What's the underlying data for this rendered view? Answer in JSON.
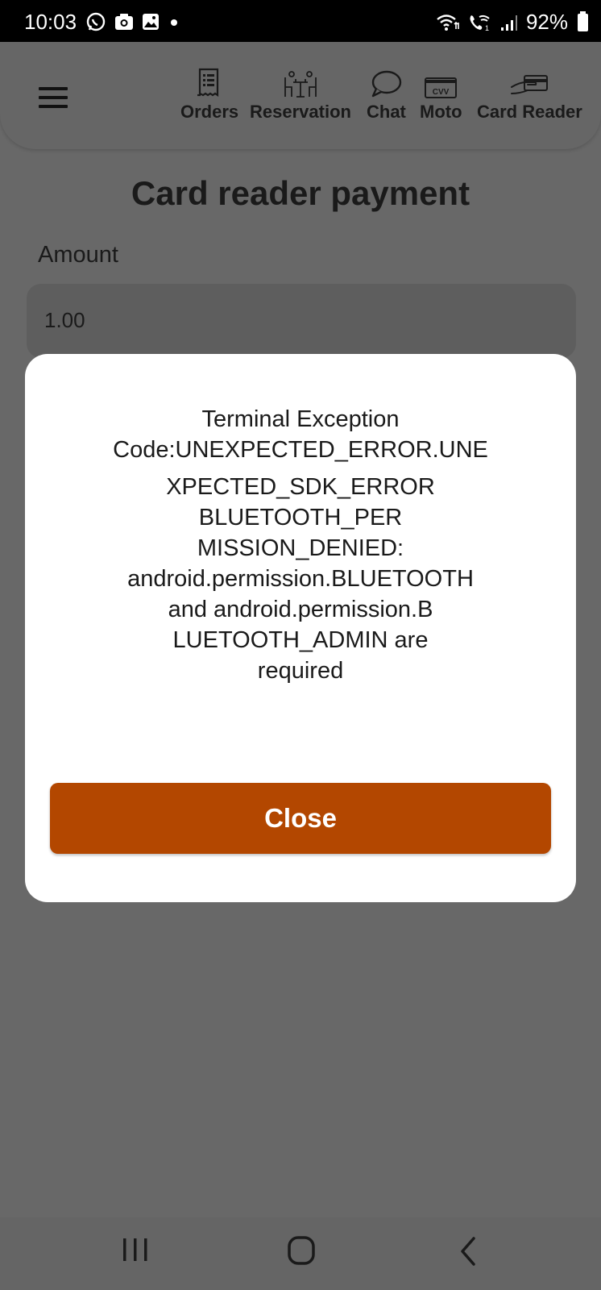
{
  "status_bar": {
    "time": "10:03",
    "battery": "92%",
    "icons": [
      "whatsapp-icon",
      "camera-icon",
      "gallery-icon",
      "dot-icon",
      "wifi-icon",
      "wifi-calling-icon",
      "signal-icon",
      "battery-icon"
    ]
  },
  "header": {
    "tabs": [
      {
        "label": "Orders",
        "icon": "receipt-icon"
      },
      {
        "label": "Reservation",
        "icon": "dining-table-icon"
      },
      {
        "label": "Chat",
        "icon": "chat-bubble-icon"
      },
      {
        "label": "Moto",
        "icon": "cvv-card-icon"
      },
      {
        "label": "Card Reader",
        "icon": "card-reader-icon"
      }
    ]
  },
  "page": {
    "title": "Card reader payment",
    "amount_label": "Amount",
    "amount_value": "1.00"
  },
  "dialog": {
    "lines": [
      "Terminal Exception",
      "Code:UNEXPECTED_ERROR.UNE",
      "XPECTED_SDK_ERROR",
      "BLUETOOTH_PER",
      "MISSION_DENIED:",
      "android.permission.BLUETOOTH",
      "and android.permission.B",
      "LUETOOTH_ADMIN are",
      "required"
    ],
    "close_label": "Close"
  },
  "colors": {
    "accent": "#b34700",
    "background": "#686868"
  }
}
